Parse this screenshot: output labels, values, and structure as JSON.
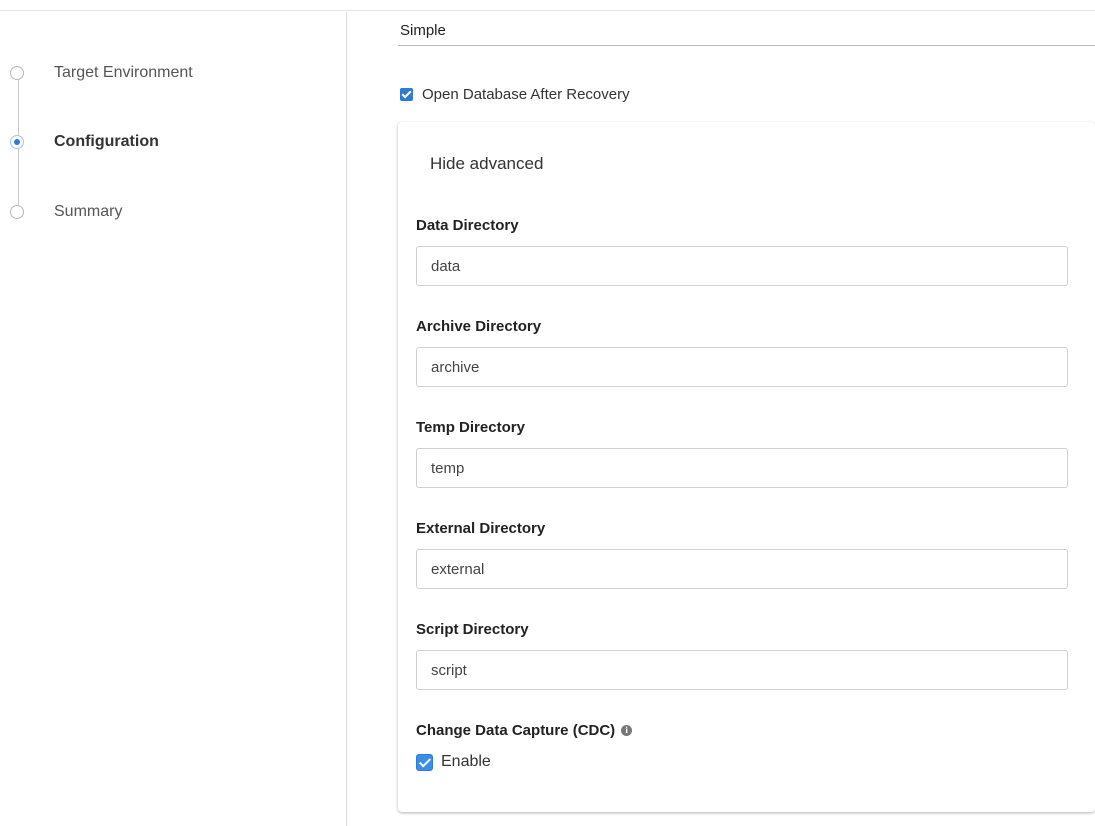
{
  "stepper": {
    "steps": [
      {
        "label": "Target Environment",
        "state": "inactive"
      },
      {
        "label": "Configuration",
        "state": "active"
      },
      {
        "label": "Summary",
        "state": "inactive"
      }
    ]
  },
  "recovery_mode": {
    "value": "Simple"
  },
  "open_database": {
    "label": "Open Database After Recovery",
    "checked": true
  },
  "advanced": {
    "toggle_label": "Hide advanced",
    "fields": [
      {
        "label": "Data Directory",
        "value": "data"
      },
      {
        "label": "Archive Directory",
        "value": "archive"
      },
      {
        "label": "Temp Directory",
        "value": "temp"
      },
      {
        "label": "External Directory",
        "value": "external"
      },
      {
        "label": "Script Directory",
        "value": "script"
      }
    ],
    "cdc": {
      "label": "Change Data Capture (CDC)",
      "info_icon": "info-icon",
      "enable_label": "Enable",
      "enabled": true
    }
  },
  "colors": {
    "accent": "#2f7ad6",
    "border": "#d0d0d0",
    "text": "#222222"
  }
}
